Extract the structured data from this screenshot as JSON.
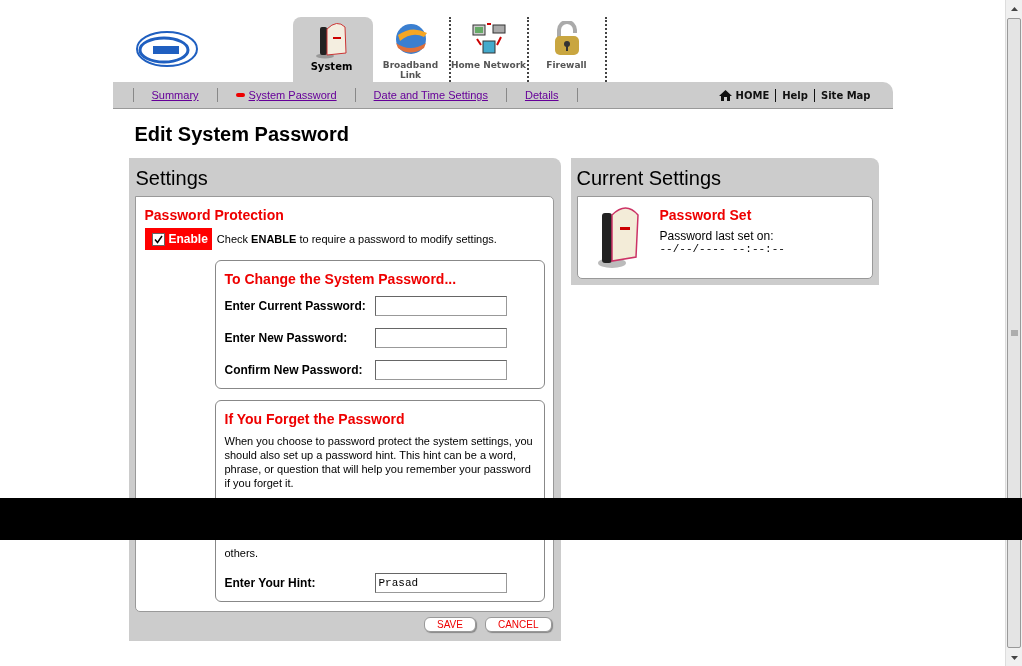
{
  "tabs": [
    {
      "label": "System",
      "selected": true
    },
    {
      "label": "Broadband Link",
      "selected": false
    },
    {
      "label": "Home Network",
      "selected": false
    },
    {
      "label": "Firewall",
      "selected": false
    }
  ],
  "subnav": [
    {
      "label": "Summary",
      "selected": false
    },
    {
      "label": "System Password",
      "selected": true
    },
    {
      "label": "Date and Time Settings",
      "selected": false
    },
    {
      "label": "Details",
      "selected": false
    }
  ],
  "utility_links": [
    "HOME",
    "Help",
    "Site Map"
  ],
  "page_title": "Edit System Password",
  "settings": {
    "title": "Settings",
    "protection": {
      "heading": "Password Protection",
      "enable": {
        "label": "Enable",
        "checked": true
      },
      "note": "Check **ENABLE** to require a password to modify settings."
    },
    "change": {
      "heading": "To Change the System Password...",
      "fields": [
        {
          "label": "Enter Current Password:"
        },
        {
          "label": "Enter New Password:"
        },
        {
          "label": "Confirm New Password:"
        }
      ]
    },
    "forget": {
      "heading": "If You Forget the Password",
      "paragraphs": [
        "When you choose to password protect the system settings, you should also set up a password hint. This hint can be a word, phrase, or question that will help you remember your password if you forget it.",
        "others."
      ],
      "hint": {
        "label": "Enter Your Hint:",
        "value": "Prasad"
      }
    },
    "buttons": [
      "SAVE",
      "CANCEL"
    ]
  },
  "current": {
    "title": "Current Settings",
    "status": "Password Set",
    "label": "Password last set on:",
    "value": "--/--/---- --:--:--"
  }
}
